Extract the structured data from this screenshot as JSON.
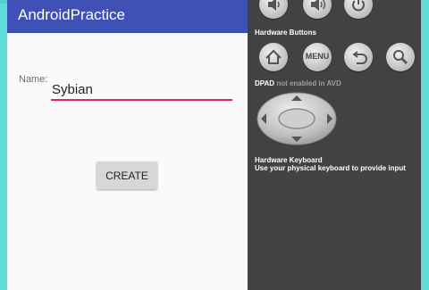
{
  "app": {
    "title": "AndroidPractice"
  },
  "form": {
    "name_label": "Name:",
    "name_value": "Sybian",
    "create_label": "CREATE"
  },
  "panel": {
    "hardware_buttons_title": "Hardware Buttons",
    "menu_label": "MENU",
    "dpad_title": "DPAD",
    "dpad_note": "not enabled in AVD",
    "keyboard_title": "Hardware Keyboard",
    "keyboard_desc": "Use your physical keyboard to provide input",
    "icons": [
      "volume-down-icon",
      "volume-up-icon",
      "power-icon",
      "home-icon",
      "menu-icon",
      "back-icon",
      "search-icon"
    ]
  },
  "colors": {
    "appbar": "#3f51b5",
    "accent": "#e91e63",
    "panel": "#424242",
    "frame": "#5fdcd9"
  }
}
